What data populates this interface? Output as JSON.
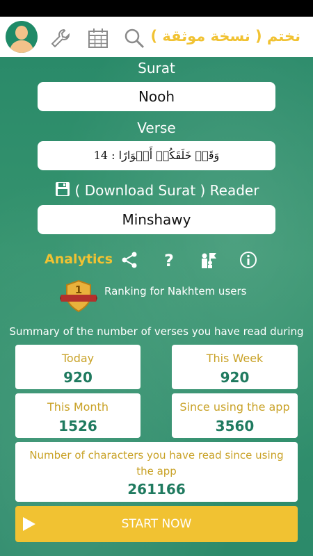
{
  "header": {
    "title": "نختم ( نسخة موثقة )"
  },
  "icons": {
    "avatar": "user-avatar-icon",
    "settings": "wrench-icon",
    "calendar": "calendar-icon",
    "search": "search-icon"
  },
  "surat": {
    "label": "Surat",
    "value": "Nooh"
  },
  "verse": {
    "label": "Verse",
    "value": "14 : وَقَدۡ خَلَقَكُمۡ أَطۡوَارًا"
  },
  "reader": {
    "label": "( Download Surat ) Reader",
    "value": "Minshawy"
  },
  "actions": {
    "analytics_label": "Analytics"
  },
  "ranking": {
    "badge_number": "1",
    "text": "Ranking for Nakhtem users"
  },
  "summary": {
    "text": "Summary of the number of verses you have read during"
  },
  "stats": {
    "today": {
      "label": "Today",
      "value": "920"
    },
    "week": {
      "label": "This Week",
      "value": "920"
    },
    "month": {
      "label": "This Month",
      "value": "1526"
    },
    "since": {
      "label": "Since using the app",
      "value": "3560"
    },
    "chars": {
      "label": "Number of characters you have read since using the app",
      "value": "261166"
    }
  },
  "start": {
    "label": "START NOW"
  },
  "colors": {
    "accent": "#f1c232",
    "green": "#2f8f6f",
    "value_green": "#1f7a5f"
  }
}
